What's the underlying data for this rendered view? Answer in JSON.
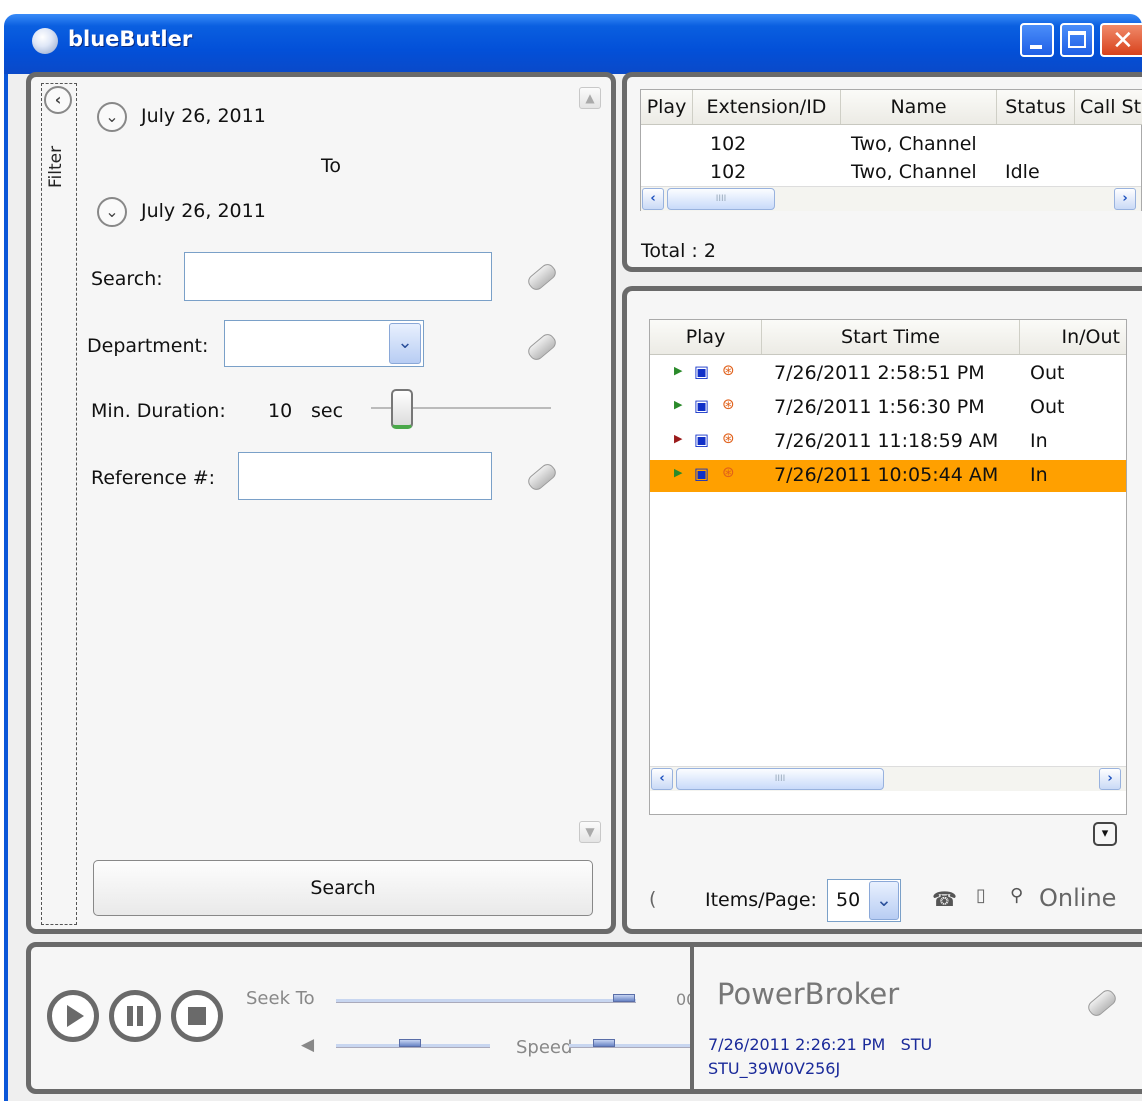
{
  "window": {
    "title": "blueButler"
  },
  "filter": {
    "sidebar_label": "Filter",
    "date_from": "July 26, 2011",
    "to_label": "To",
    "date_to": "July 26, 2011",
    "search_label": "Search:",
    "search_value": "",
    "department_label": "Department:",
    "department_value": "",
    "min_duration_label": "Min. Duration:",
    "min_duration_value": "10",
    "min_duration_unit": "sec",
    "reference_label": "Reference #:",
    "reference_value": "",
    "search_button": "Search"
  },
  "extensions": {
    "columns": [
      "Play",
      "Extension/ID",
      "Name",
      "Status",
      "Call St"
    ],
    "rows": [
      {
        "ext": "102",
        "name": "Two, Channel",
        "status": ""
      },
      {
        "ext": "102",
        "name": "Two, Channel",
        "status": "Idle"
      }
    ],
    "total_label": "Total",
    "total_value": ": 2"
  },
  "calls": {
    "columns": [
      "Play",
      "Start Time",
      "In/Out"
    ],
    "rows": [
      {
        "start": "7/26/2011 2:58:51 PM",
        "dir": "Out",
        "arrow_color": "#2a8a2a",
        "selected": false
      },
      {
        "start": "7/26/2011 1:56:30 PM",
        "dir": "Out",
        "arrow_color": "#2a8a2a",
        "selected": false
      },
      {
        "start": "7/26/2011 11:18:59 AM",
        "dir": "In",
        "arrow_color": "#9a1a1a",
        "selected": false
      },
      {
        "start": "7/26/2011 10:05:44 AM",
        "dir": "In",
        "arrow_color": "#2a8a2a",
        "selected": true
      }
    ],
    "items_per_page_label": "Items/Page:",
    "items_per_page_value": "50",
    "status_text": "Online"
  },
  "player": {
    "seek_label": "Seek To",
    "seek_time_partial": "00",
    "speed_label": "Speed"
  },
  "info": {
    "title": "PowerBroker",
    "line1": "7/26/2011 2:26:21 PM   STU",
    "line2": "STU_39W0V256J"
  },
  "colors": {
    "selection": "#ffa000",
    "titlebar": "#0a5fe0",
    "panel_border": "#6a6a6a"
  }
}
